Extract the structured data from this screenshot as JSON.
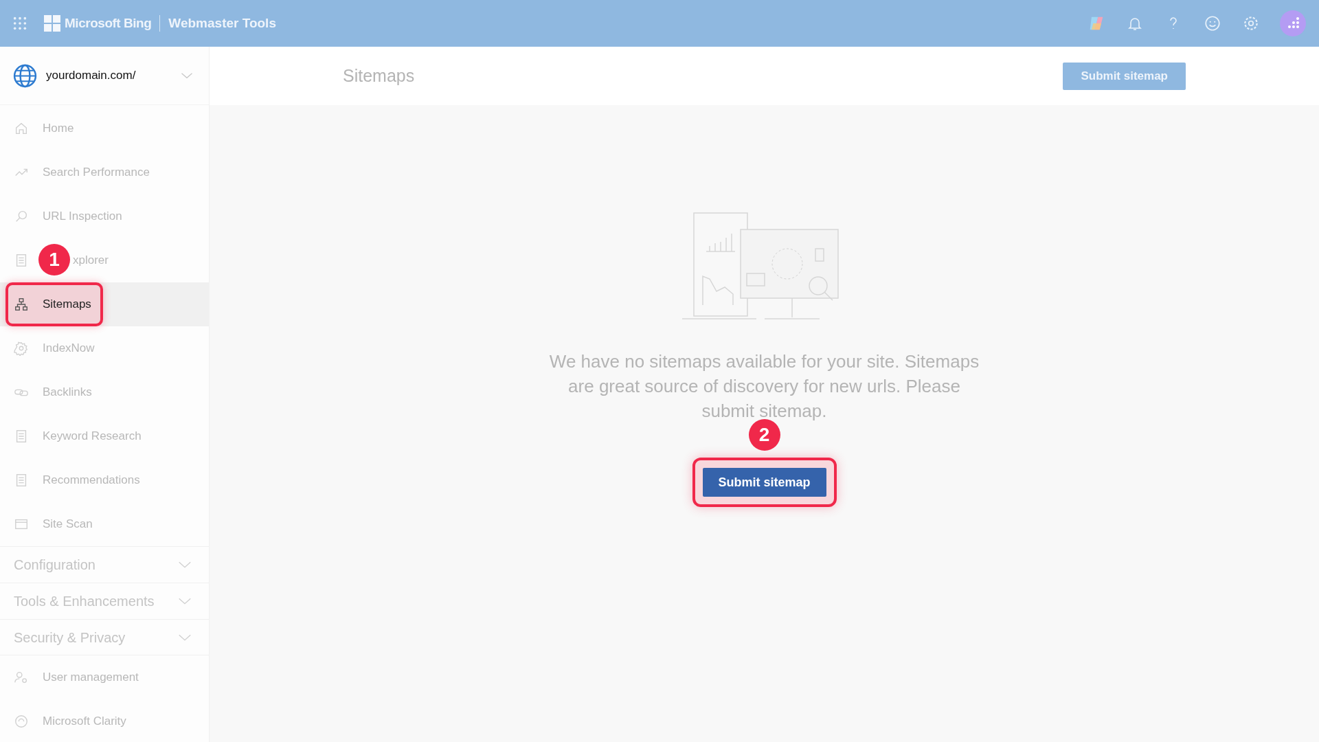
{
  "top_bar": {
    "brand": "Microsoft Bing",
    "product": "Webmaster Tools"
  },
  "site_picker": {
    "value": "yourdomain.com/"
  },
  "page": {
    "title": "Sitemaps",
    "action": "Submit sitemap"
  },
  "sidebar": {
    "items": [
      {
        "kind": "item",
        "label": "Home",
        "selected": false
      },
      {
        "kind": "item",
        "label": "Search Performance",
        "selected": false
      },
      {
        "kind": "item",
        "label": "URL Inspection",
        "selected": false
      },
      {
        "kind": "item",
        "label": "xplorer",
        "selected": false
      },
      {
        "kind": "item",
        "label": "Sitemaps",
        "selected": true,
        "callout": "1"
      },
      {
        "kind": "item",
        "label": "IndexNow",
        "selected": false
      },
      {
        "kind": "item",
        "label": "Backlinks",
        "selected": false
      },
      {
        "kind": "item",
        "label": "Keyword Research",
        "selected": false
      },
      {
        "kind": "item",
        "label": "Recommendations",
        "selected": false
      },
      {
        "kind": "item",
        "label": "Site Scan",
        "selected": false
      },
      {
        "kind": "section",
        "label": "Configuration",
        "expanded": false
      },
      {
        "kind": "section",
        "label": "Tools & Enhancements",
        "expanded": false
      },
      {
        "kind": "section",
        "label": "Security & Privacy",
        "expanded": false
      },
      {
        "kind": "item",
        "label": "User management",
        "selected": false
      },
      {
        "kind": "item",
        "label": "Microsoft Clarity",
        "selected": false
      }
    ]
  },
  "empty_state": {
    "message": "We have no sitemaps available for your site. Sitemaps are great source of discovery for new urls. Please submit sitemap.",
    "button": "Submit sitemap",
    "callout": "2"
  }
}
